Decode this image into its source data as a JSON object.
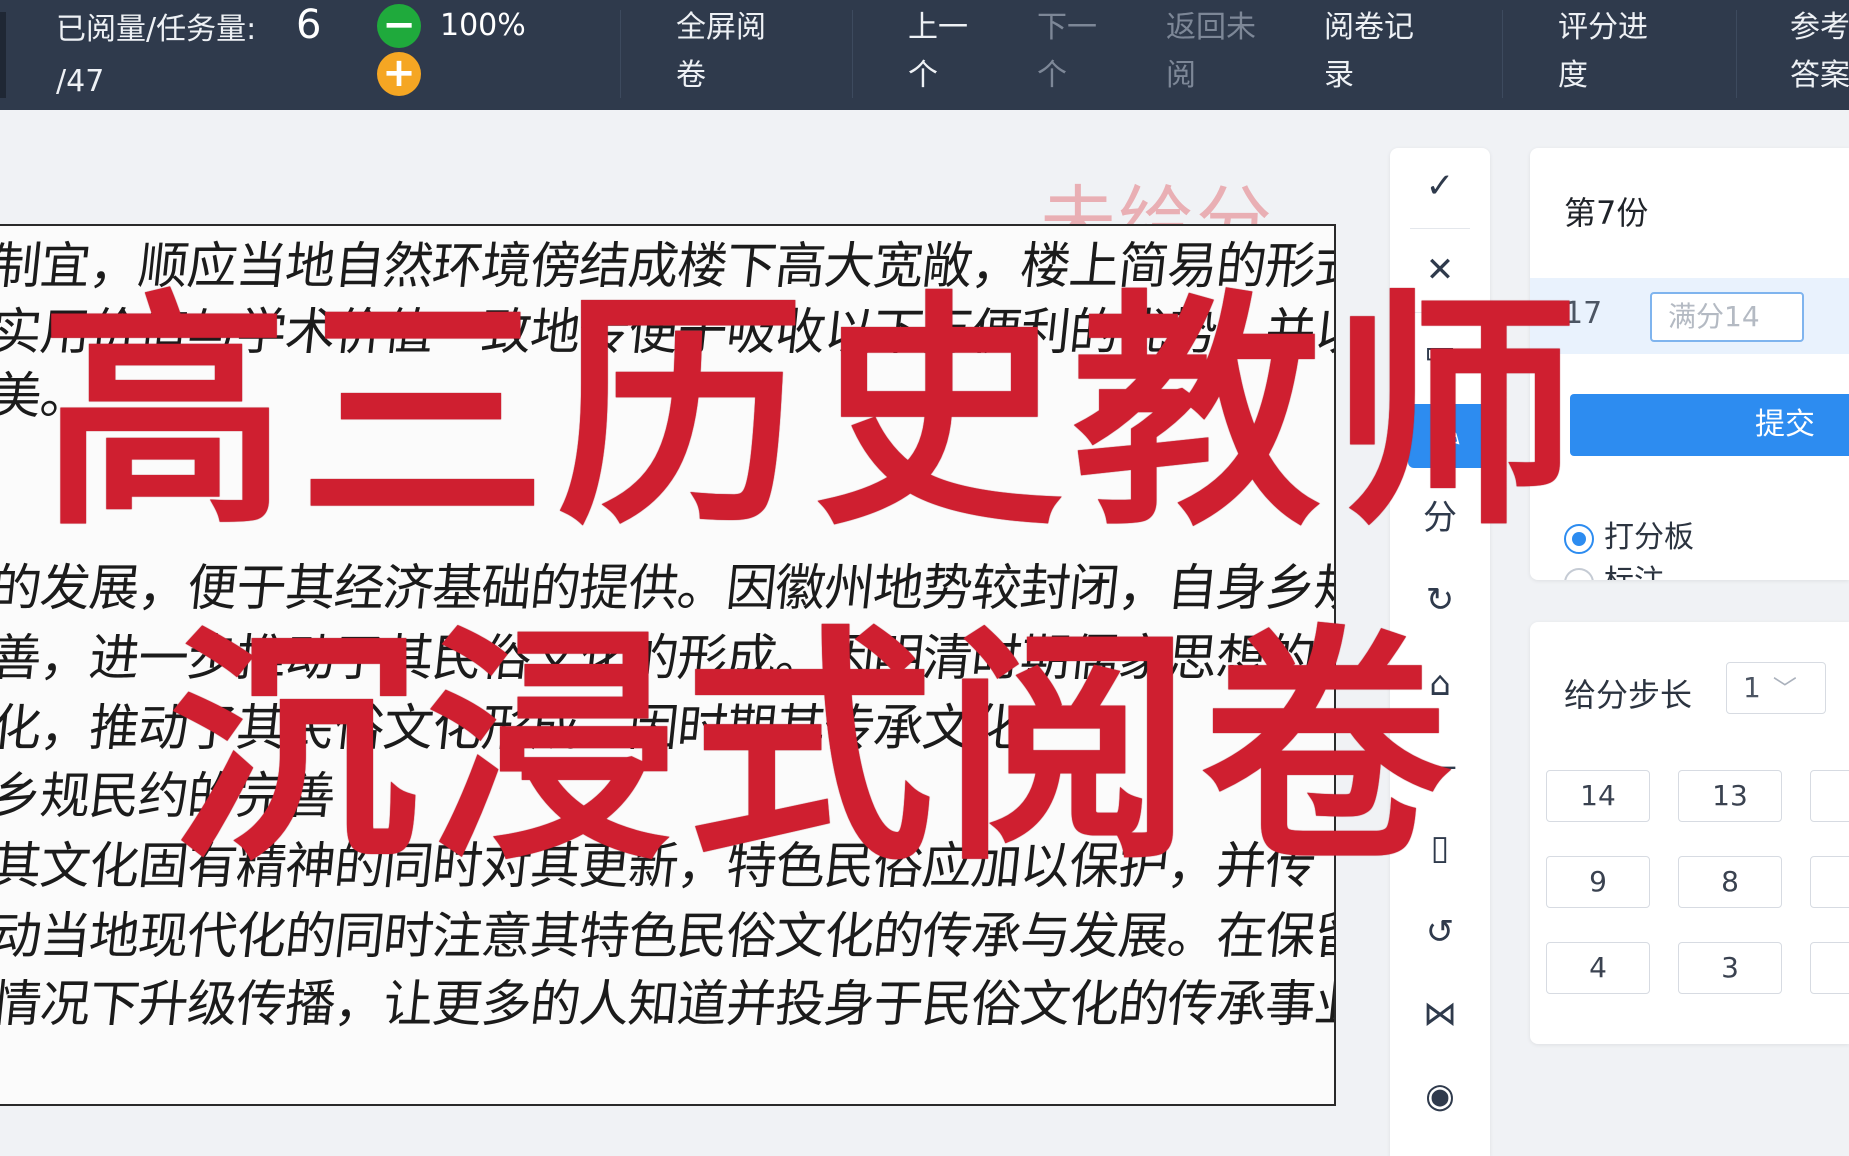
{
  "topbar": {
    "progress_label": "已阅量/任务量:",
    "progress_done": "6",
    "progress_total": "/47",
    "zoom_minus": "−",
    "zoom_plus": "+",
    "zoom": "100%",
    "buttons": [
      {
        "label": "全屏阅卷",
        "enabled": true
      },
      {
        "label": "上一个",
        "enabled": true
      },
      {
        "label": "下一个",
        "enabled": false
      },
      {
        "label": "返回未阅",
        "enabled": false
      },
      {
        "label": "阅卷记录",
        "enabled": true
      },
      {
        "label": "评分进度",
        "enabled": true
      },
      {
        "label": "参考答案",
        "enabled": true
      }
    ]
  },
  "paper": {
    "status_stamp": "未给分",
    "lines": [
      "制宜，顺应当地自然环境傍结成楼下高大宽敞，楼上简易的形式",
      "实用价值与学术价值一致地传便于吸收以下万便利的优势，并以",
      "美。",
      "",
      "的发展，便于其经济基础的提供。因徽州地势较封闭，自身乡规",
      "善，进一步推动了其民俗文化的形成。因明清时期儒家思想的进一步发",
      "化，推动了其民俗文化形成。因时期其传承文化",
      "乡规民约的完善",
      "其文化固有精神的同时对其更新，特色民俗应加以保护，并传",
      "动当地现代化的同时注意其特色民俗文化的传承与发展。在保留",
      "情况下升级传播，让更多的人知道并投身于民俗文化的传承事业中来。"
    ]
  },
  "overlay": {
    "line1": "高三历史教师",
    "line2": "沉浸式阅卷"
  },
  "tools": [
    {
      "name": "check-tool",
      "glyph": "✓"
    },
    {
      "name": "cross-tool",
      "glyph": "✕"
    },
    {
      "name": "comment-tool",
      "glyph": "▭"
    },
    {
      "name": "pen-tool",
      "glyph": "✎"
    },
    {
      "name": "score-tool",
      "glyph": "分"
    },
    {
      "name": "undo-tool",
      "glyph": "↻"
    },
    {
      "name": "stamp-tool",
      "glyph": "⌂"
    },
    {
      "name": "line-tool",
      "glyph": "—"
    },
    {
      "name": "delete-tool",
      "glyph": "▯"
    },
    {
      "name": "rotate-tool",
      "glyph": "↺"
    },
    {
      "name": "share-tool",
      "glyph": "⋈"
    },
    {
      "name": "view-tool",
      "glyph": "◉"
    }
  ],
  "grading": {
    "copy_label": "第7份",
    "question_number": "17",
    "score_placeholder": "满分14",
    "submit_label": "提交",
    "mode_options": [
      "打分板",
      "标注"
    ],
    "step_label": "给分步长",
    "step_value": "1",
    "step_caret": "﹀",
    "keys": [
      "14",
      "13",
      "9",
      "8",
      "4",
      "3"
    ]
  },
  "colors": {
    "topbar": "#2f3a4c",
    "accent": "#2d8cf0",
    "overlay_red": "#cf1f30",
    "zoom_minus": "#1faa3c",
    "zoom_plus": "#f5a623"
  }
}
